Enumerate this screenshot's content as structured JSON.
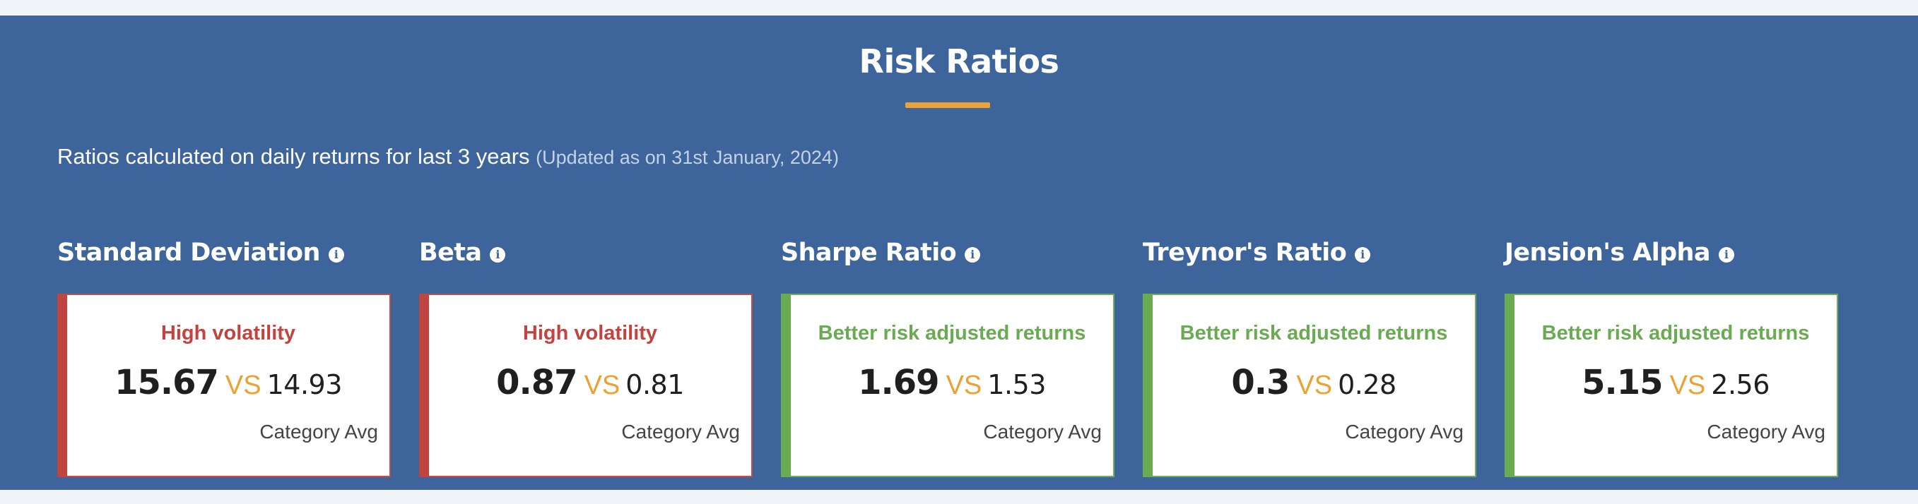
{
  "section": {
    "title": "Risk Ratios",
    "subtitle": "Ratios calculated on daily returns for last 3 years",
    "updated": "(Updated as on 31st January, 2024)",
    "info_icon": "info-circle-icon",
    "vs_label": "VS",
    "category_label": "Category Avg"
  },
  "colors": {
    "background": "#3e649c",
    "accent": "#e9a233",
    "negative": "#c0443f",
    "positive": "#6aab52"
  },
  "metrics": [
    {
      "name": "Standard Deviation",
      "verdict": "High volatility",
      "status": "negative",
      "value": "15.67",
      "category_avg": "14.93"
    },
    {
      "name": "Beta",
      "verdict": "High volatility",
      "status": "negative",
      "value": "0.87",
      "category_avg": "0.81"
    },
    {
      "name": "Sharpe Ratio",
      "verdict": "Better risk adjusted returns",
      "status": "positive",
      "value": "1.69",
      "category_avg": "1.53"
    },
    {
      "name": "Treynor's Ratio",
      "verdict": "Better risk adjusted returns",
      "status": "positive",
      "value": "0.3",
      "category_avg": "0.28"
    },
    {
      "name": "Jension's Alpha",
      "verdict": "Better risk adjusted returns",
      "status": "positive",
      "value": "5.15",
      "category_avg": "2.56"
    }
  ]
}
